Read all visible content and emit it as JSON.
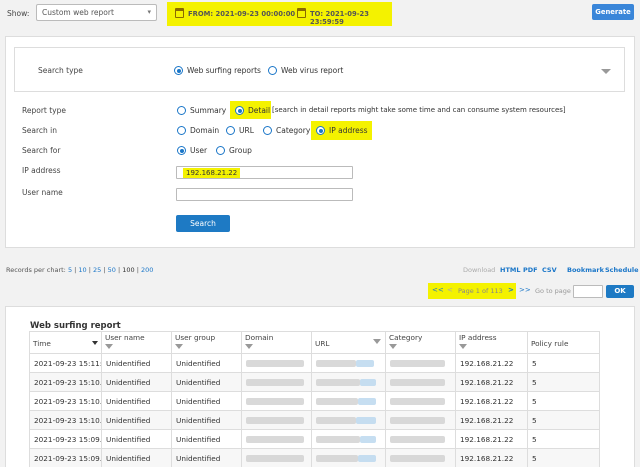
{
  "topbar": {
    "show_label": "Show:",
    "report_select": "Custom web report",
    "from_text": "FROM: 2021-09-23 00:00:00",
    "to_text": "TO: 2021-09-23 23:59:59",
    "generate_label": "Generate"
  },
  "search": {
    "search_type_label": "Search type",
    "search_type_options": [
      "Web surfing reports",
      "Web virus report"
    ],
    "report_type_label": "Report type",
    "report_type_options": [
      "Summary",
      "Detail"
    ],
    "detail_note": "[search in detail reports might take some time and can consume system resources]",
    "search_in_label": "Search in",
    "search_in_options": [
      "Domain",
      "URL",
      "Category",
      "IP address"
    ],
    "search_for_label": "Search for",
    "search_for_options": [
      "User",
      "Group"
    ],
    "ip_label": "IP address",
    "ip_value": "192.168.21.22",
    "username_label": "User name",
    "username_value": "",
    "search_button": "Search"
  },
  "records": {
    "label": "Records per chart:",
    "options": [
      "5",
      "10",
      "25",
      "50",
      "100",
      "200"
    ],
    "selected": "100"
  },
  "toplinks": {
    "download": "Download",
    "html": "HTML",
    "pdf": "PDF",
    "csv": "CSV",
    "bookmark": "Bookmark",
    "schedule": "Schedule"
  },
  "pager": {
    "first": "<<",
    "prev": "<",
    "text": "Page 1 of 113",
    "next": ">",
    "last": ">>",
    "goto_label": "Go to page",
    "ok": "OK"
  },
  "report": {
    "title": "Web surfing report",
    "columns": [
      "Time",
      "User name",
      "User group",
      "Domain",
      "URL",
      "Category",
      "IP address",
      "Policy rule"
    ],
    "rows": [
      {
        "time": "2021-09-23 15:11:..",
        "user": "Unidentified",
        "group": "Unidentified",
        "ip": "192.168.21.22",
        "policy": "5"
      },
      {
        "time": "2021-09-23 15:10..",
        "user": "Unidentified",
        "group": "Unidentified",
        "ip": "192.168.21.22",
        "policy": "5"
      },
      {
        "time": "2021-09-23 15:10..",
        "user": "Unidentified",
        "group": "Unidentified",
        "ip": "192.168.21.22",
        "policy": "5"
      },
      {
        "time": "2021-09-23 15:10..",
        "user": "Unidentified",
        "group": "Unidentified",
        "ip": "192.168.21.22",
        "policy": "5"
      },
      {
        "time": "2021-09-23 15:09..",
        "user": "Unidentified",
        "group": "Unidentified",
        "ip": "192.168.21.22",
        "policy": "5"
      },
      {
        "time": "2021-09-23 15:09..",
        "user": "Unidentified",
        "group": "Unidentified",
        "ip": "192.168.21.22",
        "policy": "5"
      }
    ]
  },
  "colors": {
    "highlight": "#f4f200",
    "accent": "#1a76c8",
    "generate": "#3a86d9"
  }
}
